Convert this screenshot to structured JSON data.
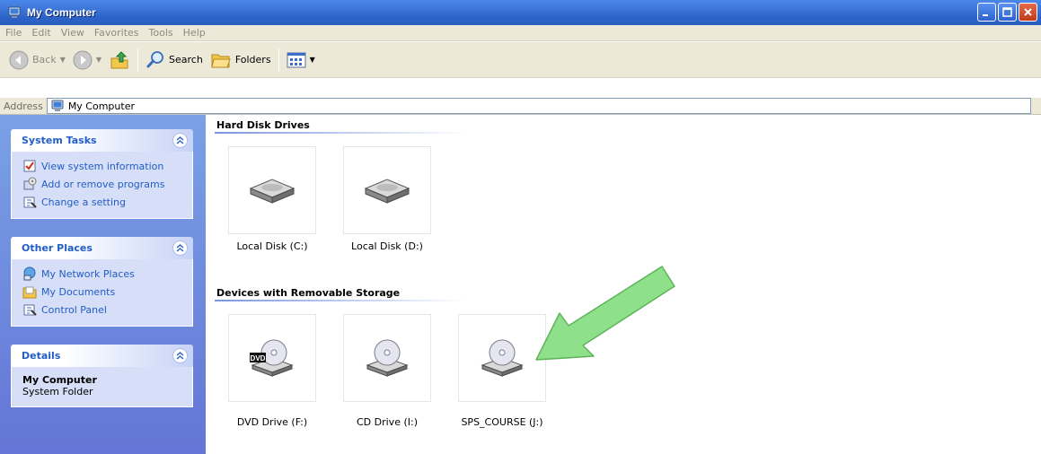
{
  "window": {
    "title": "My Computer",
    "app_icon": "my-computer-icon",
    "buttons": [
      "minimize",
      "maximize",
      "close"
    ]
  },
  "menubar": {
    "items": [
      "File",
      "Edit",
      "View",
      "Favorites",
      "Tools",
      "Help"
    ]
  },
  "toolbar": {
    "back_label": "Back",
    "search_label": "Search",
    "folders_label": "Folders",
    "icons": [
      "back-arrow-icon",
      "forward-arrow-icon",
      "up-folder-icon",
      "search-icon",
      "folders-icon",
      "views-icon"
    ]
  },
  "address": {
    "label": "Address",
    "value": "My Computer"
  },
  "sidebar": {
    "system_tasks": {
      "title": "System Tasks",
      "items": [
        {
          "label": "View system information",
          "icon": "system-info-icon"
        },
        {
          "label": "Add or remove programs",
          "icon": "add-remove-programs-icon"
        },
        {
          "label": "Change a setting",
          "icon": "control-panel-icon"
        }
      ]
    },
    "other_places": {
      "title": "Other Places",
      "items": [
        {
          "label": "My Network Places",
          "icon": "network-places-icon"
        },
        {
          "label": "My Documents",
          "icon": "my-documents-icon"
        },
        {
          "label": "Control Panel",
          "icon": "control-panel-icon"
        }
      ]
    },
    "details": {
      "title": "Details",
      "name": "My Computer",
      "type": "System Folder"
    }
  },
  "main": {
    "hard_disks": {
      "title": "Hard Disk Drives",
      "items": [
        {
          "label": "Local Disk (C:)",
          "icon": "hard-disk-icon"
        },
        {
          "label": "Local Disk (D:)",
          "icon": "hard-disk-icon"
        }
      ]
    },
    "removable": {
      "title": "Devices with Removable Storage",
      "items": [
        {
          "label": "DVD Drive (F:)",
          "icon": "dvd-drive-icon",
          "badge": "DVD"
        },
        {
          "label": "CD Drive (I:)",
          "icon": "cd-drive-icon"
        },
        {
          "label": "SPS_COURSE (J:)",
          "icon": "cd-drive-icon"
        }
      ]
    }
  },
  "annotation": {
    "icon": "green-arrow-icon",
    "color": "#8ee08a"
  }
}
